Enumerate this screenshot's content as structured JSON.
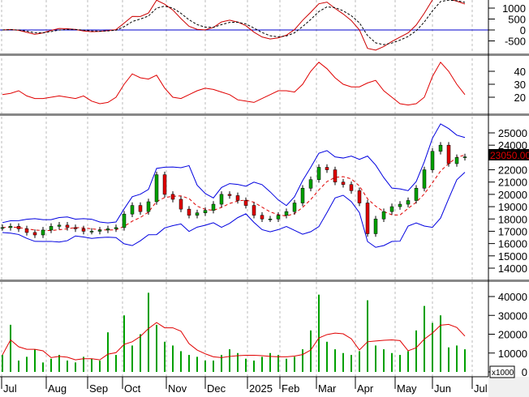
{
  "chart_data": {
    "type": "candlestick",
    "title": "",
    "last_price_label": "23050.00",
    "x_labels": [
      "Jul",
      "Aug",
      "Sep",
      "Oct",
      "Nov",
      "Dec",
      "2025",
      "Feb",
      "Mar",
      "Apr",
      "May",
      "Jun",
      "Jul"
    ],
    "closes": [
      17300,
      17400,
      17200,
      16900,
      16700,
      17100,
      17400,
      17500,
      17300,
      17200,
      17000,
      17000,
      17100,
      17200,
      17300,
      18400,
      19100,
      18600,
      19400,
      21600,
      20000,
      19600,
      18800,
      18300,
      18500,
      18700,
      19200,
      20000,
      19900,
      19500,
      19100,
      18300,
      18000,
      18000,
      18300,
      18600,
      19300,
      20500,
      21200,
      22200,
      22000,
      21000,
      20800,
      20300,
      19300,
      16800,
      18000,
      18600,
      19000,
      19200,
      19500,
      20500,
      22000,
      23500,
      24000,
      22500,
      23000,
      23050
    ],
    "indicator2": [
      22,
      23,
      25,
      21,
      19,
      19,
      20,
      21,
      20,
      19,
      21,
      17,
      15,
      16,
      20,
      30,
      38,
      35,
      34,
      37,
      27,
      20,
      19,
      22,
      25,
      27,
      26,
      24,
      22,
      18,
      17,
      16,
      19,
      22,
      25,
      25,
      24,
      30,
      40,
      47,
      42,
      35,
      30,
      28,
      28,
      31,
      33,
      25,
      20,
      15,
      14,
      15,
      20,
      36,
      47,
      40,
      30,
      22
    ],
    "volumes": [
      9000,
      25000,
      6000,
      8000,
      12000,
      5000,
      7000,
      9000,
      6000,
      5000,
      8000,
      7000,
      6000,
      21000,
      9000,
      30000,
      14000,
      20000,
      42000,
      25000,
      16000,
      14000,
      11000,
      9000,
      8000,
      6000,
      6000,
      9000,
      12000,
      10000,
      7000,
      6000,
      8000,
      10000,
      9000,
      7000,
      8000,
      12000,
      22000,
      41000,
      16000,
      12000,
      10000,
      9000,
      11000,
      38000,
      14000,
      12000,
      10000,
      9000,
      11000,
      22000,
      35000,
      26000,
      30000,
      13000,
      14000,
      12000
    ],
    "macd_ticks": [
      "1000",
      "500",
      "0",
      "-500"
    ],
    "ind2_ticks": [
      "40",
      "30",
      "20"
    ],
    "price_ticks": [
      "25000",
      "24000",
      "22000",
      "21000",
      "20000",
      "19000",
      "18000",
      "17000",
      "16000",
      "15000",
      "14000"
    ],
    "volume_ticks": [
      "40000",
      "30000",
      "20000",
      "10000",
      "0"
    ],
    "volume_unit": "x1000",
    "colors": {
      "up": "#00a000",
      "down": "#e00000",
      "ma": "#e00000",
      "band": "#0000e0",
      "signal": "#e00000"
    }
  }
}
